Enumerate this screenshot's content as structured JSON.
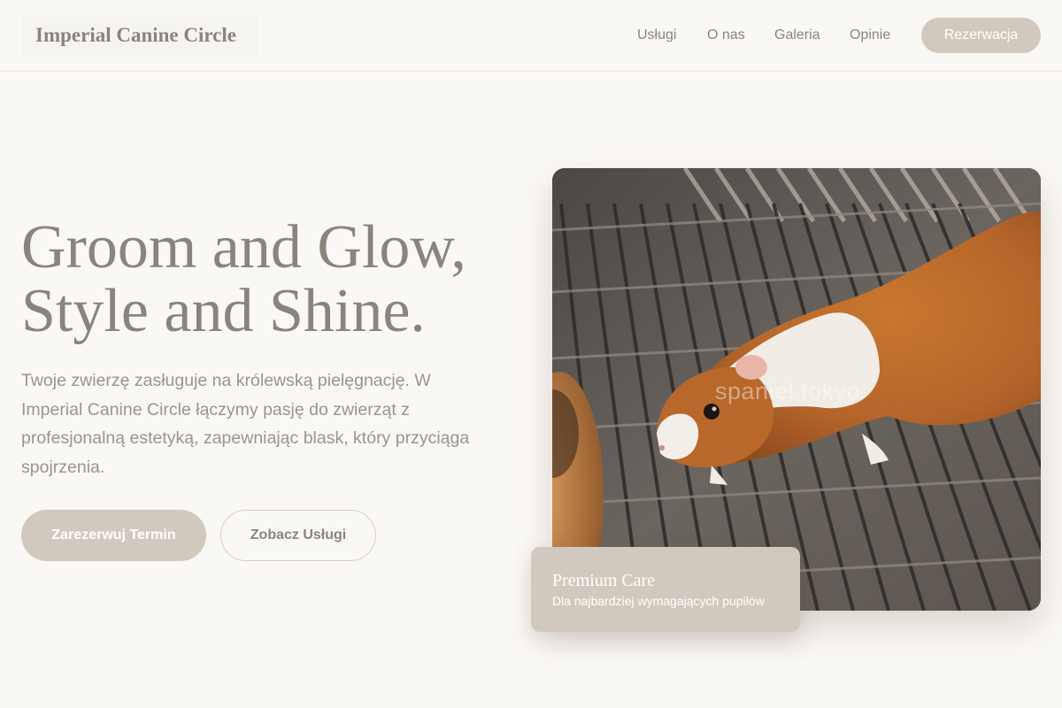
{
  "header": {
    "brand": "Imperial Canine Circle",
    "nav": [
      "Usługi",
      "O nas",
      "Galeria",
      "Opinie"
    ],
    "reserve_label": "Rezerwacja"
  },
  "hero": {
    "title_line1": "Groom and Glow,",
    "title_line2": "Style and Shine.",
    "description": "Twoje zwierzę zasługuje na królewską pielęgnację. W Imperial Canine Circle łączymy pasję do zwierząt z profesjonalną estetyką, zapewniając blask, który przyciąga spojrzenia.",
    "primary_button": "Zarezerwuj Termin",
    "secondary_button": "Zobacz Usługi",
    "image": {
      "subject": "guinea-pig-on-wire-grate-photo",
      "watermark": "spaniel.tokyo"
    }
  },
  "card": {
    "title": "Premium Care",
    "subtitle": "Dla najbardziej wymagających pupilów"
  },
  "colors": {
    "background": "#faf8f5",
    "accent": "#d2c9be",
    "text": "#8a847d",
    "muted_text": "#9a948d"
  }
}
